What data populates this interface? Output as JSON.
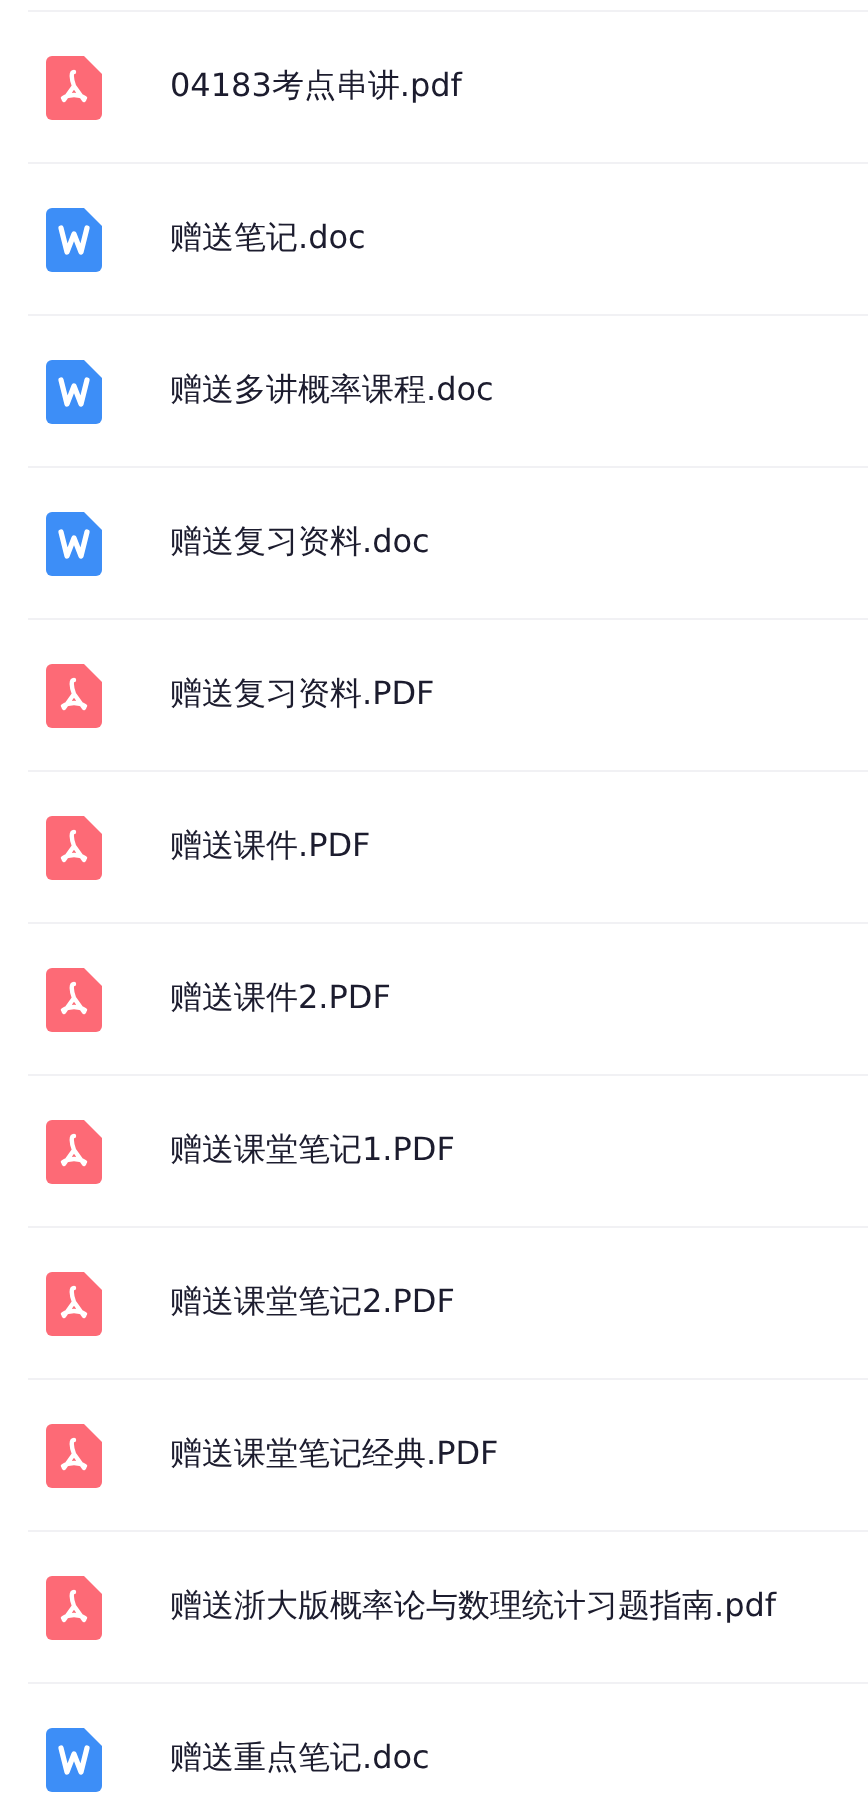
{
  "files": [
    {
      "kind": "pdf",
      "name": "04183考点串讲.pdf"
    },
    {
      "kind": "word",
      "name": "赠送笔记.doc"
    },
    {
      "kind": "word",
      "name": "赠送多讲概率课程.doc"
    },
    {
      "kind": "word",
      "name": "赠送复习资料.doc"
    },
    {
      "kind": "pdf",
      "name": "赠送复习资料.PDF"
    },
    {
      "kind": "pdf",
      "name": "赠送课件.PDF"
    },
    {
      "kind": "pdf",
      "name": "赠送课件2.PDF"
    },
    {
      "kind": "pdf",
      "name": "赠送课堂笔记1.PDF"
    },
    {
      "kind": "pdf",
      "name": "赠送课堂笔记2.PDF"
    },
    {
      "kind": "pdf",
      "name": "赠送课堂笔记经典.PDF"
    },
    {
      "kind": "pdf",
      "name": "赠送浙大版概率论与数理统计习题指南.pdf"
    },
    {
      "kind": "word",
      "name": "赠送重点笔记.doc"
    }
  ]
}
